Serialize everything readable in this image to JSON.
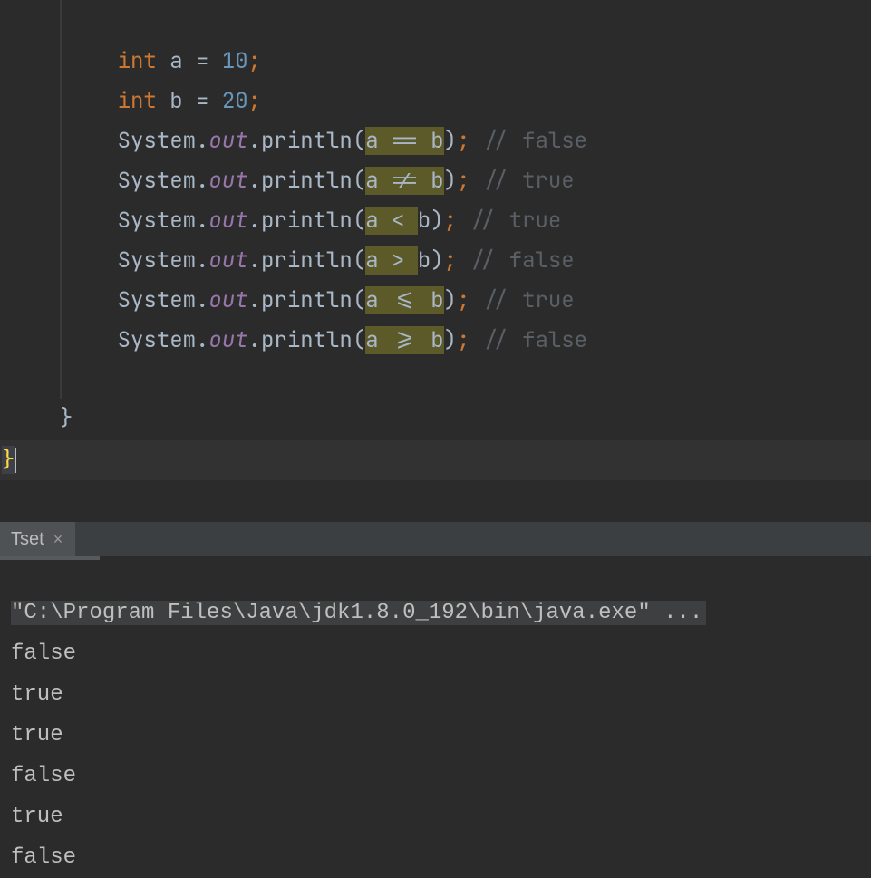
{
  "editor": {
    "decl_a": {
      "kw": "int",
      "name": "a",
      "eq": "=",
      "val": "10",
      "semi": ";"
    },
    "decl_b": {
      "kw": "int",
      "name": "b",
      "eq": "=",
      "val": "20",
      "semi": ";"
    },
    "lines": [
      {
        "obj": "System",
        "dot1": ".",
        "field": "out",
        "dot2": ".",
        "method": "println",
        "lp": "(",
        "a": "a",
        "op": " == ",
        "b": "b",
        "rp": ")",
        "semi": ";",
        "cm": " // false"
      },
      {
        "obj": "System",
        "dot1": ".",
        "field": "out",
        "dot2": ".",
        "method": "println",
        "lp": "(",
        "a": "a",
        "op": " != ",
        "b": "b",
        "rp": ")",
        "semi": ";",
        "cm": " // true"
      },
      {
        "obj": "System",
        "dot1": ".",
        "field": "out",
        "dot2": ".",
        "method": "println",
        "lp": "(",
        "a": "a",
        "op": " < ",
        "b": "b",
        "rp": ")",
        "semi": ";",
        "cm": " // true"
      },
      {
        "obj": "System",
        "dot1": ".",
        "field": "out",
        "dot2": ".",
        "method": "println",
        "lp": "(",
        "a": "a",
        "op": " > ",
        "b": "b",
        "rp": ")",
        "semi": ";",
        "cm": " // false"
      },
      {
        "obj": "System",
        "dot1": ".",
        "field": "out",
        "dot2": ".",
        "method": "println",
        "lp": "(",
        "a": "a",
        "op": " <= ",
        "b": "b",
        "rp": ")",
        "semi": ";",
        "cm": " // true"
      },
      {
        "obj": "System",
        "dot1": ".",
        "field": "out",
        "dot2": ".",
        "method": "println",
        "lp": "(",
        "a": "a",
        "op": " >= ",
        "b": "b",
        "rp": ")",
        "semi": ";",
        "cm": " // false"
      }
    ],
    "close_brace": "}",
    "class_close_brace": "}"
  },
  "tab": {
    "label": "Tset",
    "close": "×"
  },
  "console": {
    "cmd": "\"C:\\Program Files\\Java\\jdk1.8.0_192\\bin\\java.exe\" ...",
    "out": [
      "false",
      "true",
      "true",
      "false",
      "true",
      "false"
    ]
  }
}
